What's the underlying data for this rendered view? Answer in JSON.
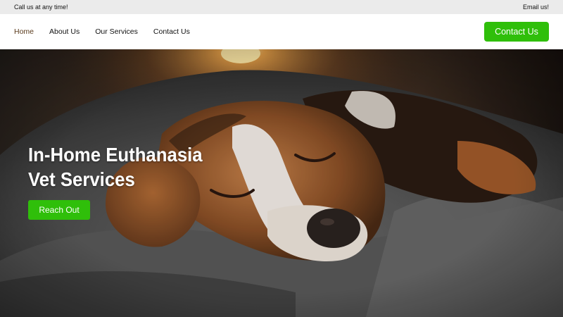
{
  "topbar": {
    "call_text": "Call us at any time!",
    "email_text": "Email us!"
  },
  "nav": {
    "items": [
      {
        "label": "Home",
        "active": true
      },
      {
        "label": "About Us",
        "active": false
      },
      {
        "label": "Our Services",
        "active": false
      },
      {
        "label": "Contact Us",
        "active": false
      }
    ],
    "cta_label": "Contact Us"
  },
  "hero": {
    "title_line1": "In-Home Euthanasia",
    "title_line2": "Vet Services",
    "button_label": "Reach Out",
    "image": "sleeping beagle dog on a gray fluffy blanket"
  },
  "colors": {
    "accent_green": "#2fbf0a",
    "topbar_bg": "#ebebeb",
    "active_nav": "#5a3b1c"
  }
}
